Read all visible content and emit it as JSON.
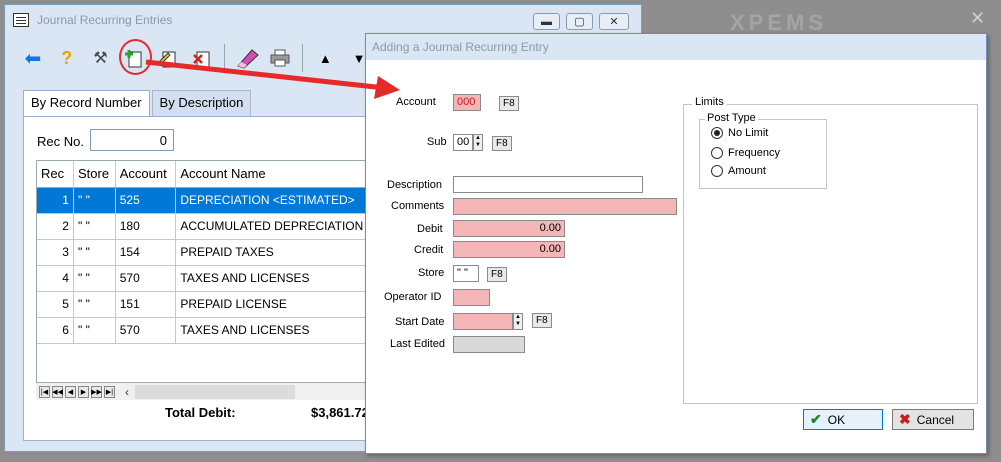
{
  "bg_window": {
    "title": "Journal Recurring Entries",
    "tabs": [
      "By Record Number",
      "By Description"
    ],
    "rec_no_label": "Rec No.",
    "rec_no_value": "0",
    "grid_headers": [
      "Rec",
      "Store",
      "Account",
      "Account Name"
    ],
    "rows": [
      {
        "rec": "1",
        "store": "\" \"",
        "account": "525",
        "name": "DEPRECIATION <ESTIMATED>"
      },
      {
        "rec": "2",
        "store": "\" \"",
        "account": "180",
        "name": "ACCUMULATED DEPRECIATION"
      },
      {
        "rec": "3",
        "store": "\" \"",
        "account": "154",
        "name": "PREPAID TAXES"
      },
      {
        "rec": "4",
        "store": "\" \"",
        "account": "570",
        "name": "TAXES AND LICENSES"
      },
      {
        "rec": "5",
        "store": "\" \"",
        "account": "151",
        "name": "PREPAID LICENSE"
      },
      {
        "rec": "6",
        "store": "\" \"",
        "account": "570",
        "name": "TAXES AND LICENSES"
      }
    ],
    "total_label": "Total Debit:",
    "total_value": "$3,861.72"
  },
  "dialog": {
    "title": "Adding a Journal Recurring Entry",
    "account_label": "Account",
    "account_value": "000",
    "sub_label": "Sub",
    "sub_value": "00",
    "description_label": "Description",
    "comments_label": "Comments",
    "debit_label": "Debit",
    "debit_value": "0.00",
    "credit_label": "Credit",
    "credit_value": "0.00",
    "store_label": "Store",
    "store_value": "\" \"",
    "operator_label": "Operator ID",
    "start_date_label": "Start Date",
    "last_edited_label": "Last Edited",
    "f8": "F8",
    "limits_label": "Limits",
    "post_type_label": "Post Type",
    "post_types": [
      "No Limit",
      "Frequency",
      "Amount"
    ],
    "ok_label": "OK",
    "cancel_label": "Cancel"
  }
}
